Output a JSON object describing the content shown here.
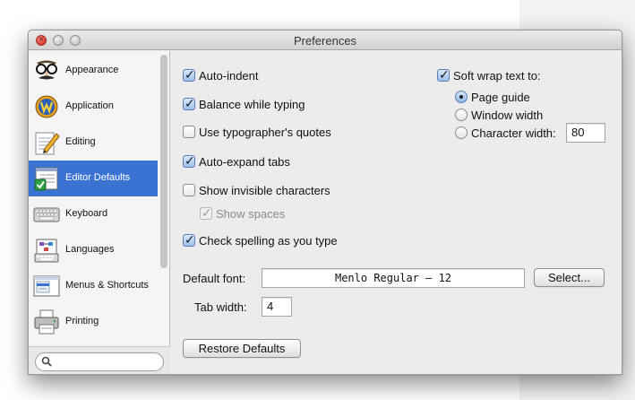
{
  "window": {
    "title": "Preferences"
  },
  "sidebar": {
    "items": [
      {
        "label": "Appearance",
        "icon": "glasses-mustache-icon"
      },
      {
        "label": "Application",
        "icon": "application-gear-icon"
      },
      {
        "label": "Editing",
        "icon": "pencil-notepad-icon"
      },
      {
        "label": "Editor Defaults",
        "icon": "document-check-icon",
        "selected": true
      },
      {
        "label": "Keyboard",
        "icon": "keyboard-icon"
      },
      {
        "label": "Languages",
        "icon": "languages-board-icon"
      },
      {
        "label": "Menus & Shortcuts",
        "icon": "menu-window-icon"
      },
      {
        "label": "Printing",
        "icon": "printer-icon"
      }
    ],
    "search": {
      "placeholder": "",
      "value": ""
    }
  },
  "options": {
    "auto_indent": {
      "label": "Auto-indent",
      "checked": true
    },
    "balance_while_typing": {
      "label": "Balance while typing",
      "checked": true
    },
    "typographers_quotes": {
      "label": "Use typographer's quotes",
      "checked": false
    },
    "auto_expand_tabs": {
      "label": "Auto-expand tabs",
      "checked": true
    },
    "show_invisibles": {
      "label": "Show invisible characters",
      "checked": false
    },
    "show_spaces": {
      "label": "Show spaces",
      "checked": true,
      "disabled": true
    },
    "check_spelling": {
      "label": "Check spelling as you type",
      "checked": true
    }
  },
  "soft_wrap": {
    "label": "Soft wrap text to:",
    "checked": true,
    "options": [
      {
        "label": "Page guide",
        "selected": true
      },
      {
        "label": "Window width",
        "selected": false
      },
      {
        "label": "Character width:",
        "selected": false
      }
    ],
    "character_width": "80"
  },
  "font": {
    "label": "Default font:",
    "value": "Menlo Regular – 12",
    "select_label": "Select..."
  },
  "tab_width": {
    "label": "Tab width:",
    "value": "4"
  },
  "restore_defaults_label": "Restore Defaults",
  "colors": {
    "selection": "#3b73d3",
    "window_bg": "#ececec",
    "sidebar_bg": "#f5f5f5"
  }
}
